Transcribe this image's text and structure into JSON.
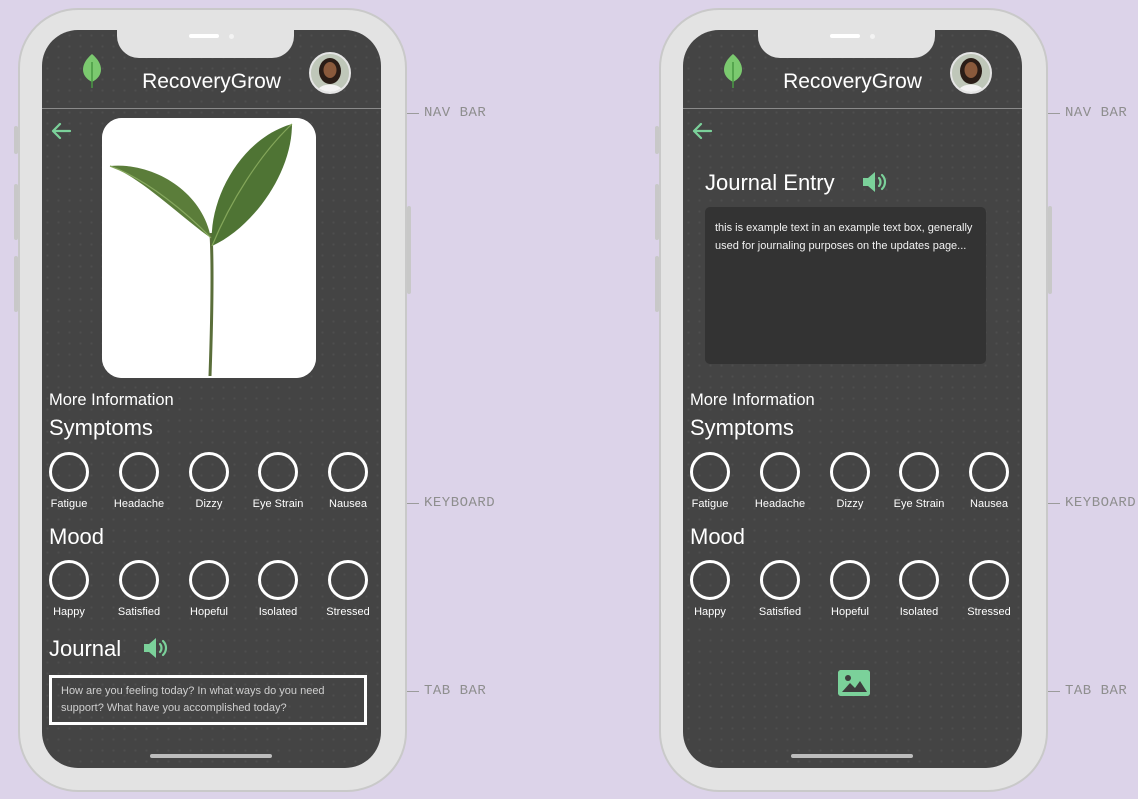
{
  "app": {
    "title": "RecoveryGrow"
  },
  "colors": {
    "accent": "#7bd19a",
    "screen": "#444444",
    "background": "#dcd3e9"
  },
  "icons": {
    "logo": "leaf-icon",
    "back": "arrow-left-icon",
    "audio": "speaker-icon",
    "image": "image-icon"
  },
  "annotations": {
    "nav_bar": "NAV BAR",
    "keyboard": "KEYBOARD",
    "tab_bar": "TAB BAR"
  },
  "left_phone": {
    "more_info": "More Information",
    "symptoms_title": "Symptoms",
    "symptoms": [
      "Fatigue",
      "Headache",
      "Dizzy",
      "Eye Strain",
      "Nausea"
    ],
    "mood_title": "Mood",
    "moods": [
      "Happy",
      "Satisfied",
      "Hopeful",
      "Isolated",
      "Stressed"
    ],
    "journal_title": "Journal",
    "journal_placeholder": "How are you feeling today? In what ways do you need support? What have you accomplished today?"
  },
  "right_phone": {
    "entry_title": "Journal Entry",
    "entry_text": "this is example text in an example text box, generally used for journaling purposes on the updates page...",
    "more_info": "More Information",
    "symptoms_title": "Symptoms",
    "symptoms": [
      "Fatigue",
      "Headache",
      "Dizzy",
      "Eye Strain",
      "Nausea"
    ],
    "mood_title": "Mood",
    "moods": [
      "Happy",
      "Satisfied",
      "Hopeful",
      "Isolated",
      "Stressed"
    ]
  }
}
